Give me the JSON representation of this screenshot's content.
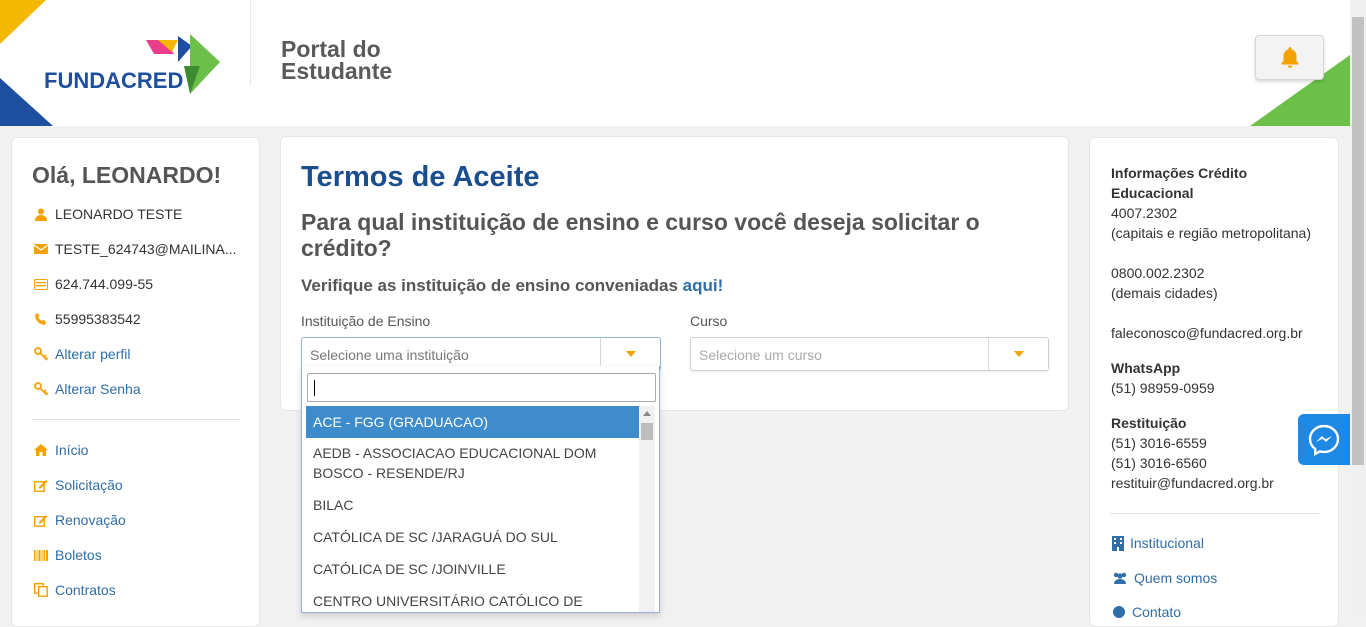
{
  "header": {
    "logo_text": "FUNDACRED",
    "portal_title_line1": "Portal do",
    "portal_title_line2": "Estudante"
  },
  "sidebar": {
    "greeting": "Olá, LEONARDO!",
    "user_name": "LEONARDO TESTE",
    "email": "TESTE_624743@MAILINA...",
    "cpf": "624.744.099-55",
    "phone": "55995383542",
    "edit_profile": "Alterar perfil",
    "change_password": "Alterar Senha",
    "nav": [
      "Início",
      "Solicitação",
      "Renovação",
      "Boletos",
      "Contratos"
    ]
  },
  "main": {
    "title": "Termos de Aceite",
    "question": "Para qual instituição de ensino e curso você deseja solicitar o crédito?",
    "verify_text": "Verifique as instituição de ensino conveniadas ",
    "verify_link": "aqui!",
    "institution_label": "Instituição de Ensino",
    "institution_placeholder": "Selecione uma instituição",
    "course_label": "Curso",
    "course_placeholder": "Selecione um curso"
  },
  "dropdown": {
    "search_value": "",
    "options": [
      "ACE - FGG (GRADUACAO)",
      "AEDB - ASSOCIACAO EDUCACIONAL DOM BOSCO - RESENDE/RJ",
      "BILAC",
      "CATÓLICA DE SC /JARAGUÁ DO SUL",
      "CATÓLICA DE SC /JOINVILLE",
      "CENTRO UNIVERSITÁRIO CATÓLICO DE VITÓRIA"
    ]
  },
  "right": {
    "credit_title": "Informações Crédito Educacional",
    "phone1": "4007.2302",
    "phone1_note": "(capitais e região metropolitana)",
    "phone2": "0800.002.2302",
    "phone2_note": "(demais cidades)",
    "email": "faleconosco@fundacred.org.br",
    "whatsapp_title": "WhatsApp",
    "whatsapp": "(51) 98959-0959",
    "restituicao_title": "Restituição",
    "rest_phone1": "(51) 3016-6559",
    "rest_phone2": "(51) 3016-6560",
    "rest_email": "restituir@fundacred.org.br",
    "links": [
      "Institucional",
      "Quem somos",
      "Contato"
    ]
  },
  "colors": {
    "brand_blue": "#1b4e8f",
    "link_blue": "#2f6ea8",
    "accent_orange": "#f5a100",
    "selected_option": "#3f8ccc",
    "header_green": "#6cc04a",
    "header_yellow": "#f5b800"
  },
  "icons": {
    "bell": "bell-icon",
    "user": "user-icon",
    "email": "envelope-icon",
    "cpf": "id-card-icon",
    "phone": "phone-icon",
    "key": "key-icon",
    "home": "home-icon",
    "edit": "edit-icon",
    "barcode": "barcode-icon",
    "contracts": "copy-icon",
    "building": "building-icon",
    "users": "users-icon",
    "messenger": "messenger-icon"
  }
}
